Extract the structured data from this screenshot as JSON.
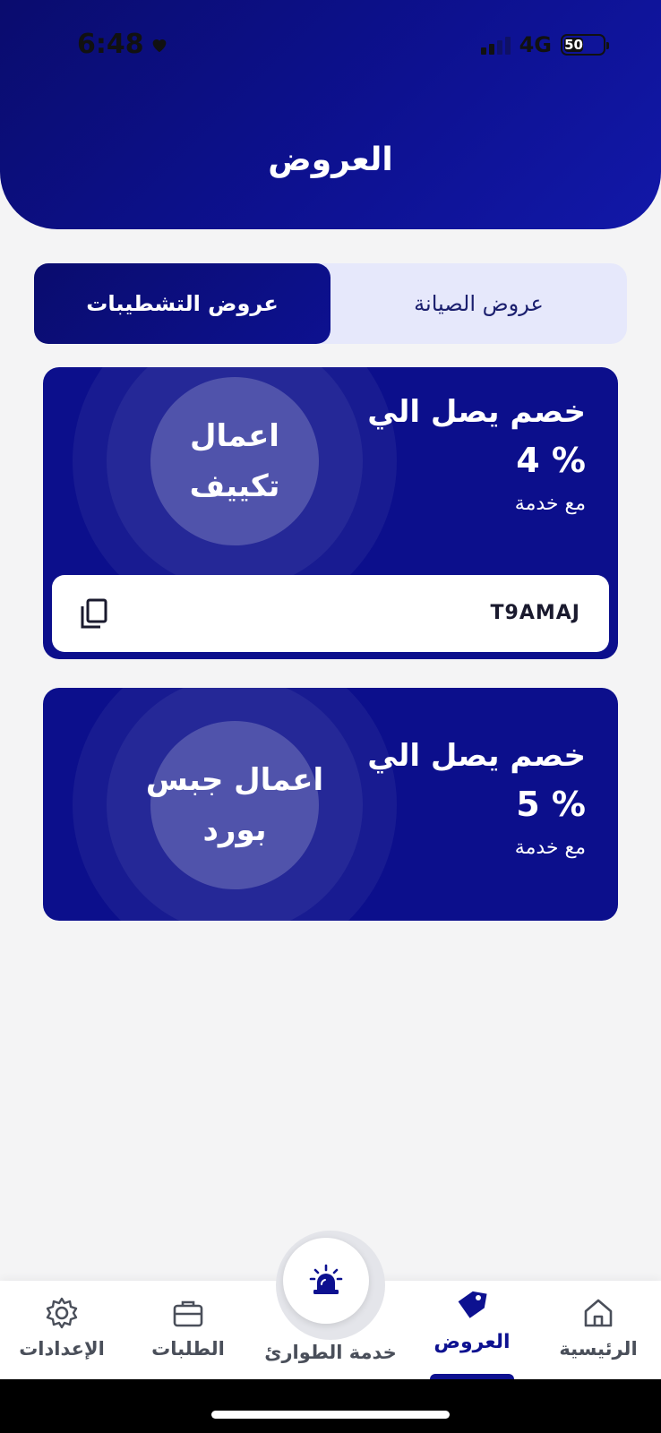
{
  "status_bar": {
    "time": "6:48",
    "network": "4G",
    "battery": "50"
  },
  "header": {
    "title": "العروض"
  },
  "segments": {
    "active_label": "عروض التشطيبات",
    "inactive_label": "عروض الصيانة"
  },
  "offers": [
    {
      "service": "اعمال تكييف",
      "headline": "خصم يصل الي",
      "discount": "4 %",
      "subtitle": "مع خدمة",
      "code": "T9AMAJ"
    },
    {
      "service": "اعمال جبس بورد",
      "headline": "خصم يصل الي",
      "discount": "5 %",
      "subtitle": "مع خدمة"
    }
  ],
  "tabbar": {
    "home": "الرئيسية",
    "offers": "العروض",
    "emergency": "خدمة الطوارئ",
    "orders": "الطلبات",
    "settings": "الإعدادات"
  },
  "colors": {
    "primary": "#0d1190",
    "card": "#0c0f8c",
    "background": "#f4f4f5",
    "segment_bg": "#e6e8fb"
  },
  "icons": [
    "heart-icon",
    "signal-icon",
    "battery-icon",
    "copy-icon",
    "home-icon",
    "tag-icon",
    "siren-icon",
    "briefcase-icon",
    "gear-icon"
  ]
}
